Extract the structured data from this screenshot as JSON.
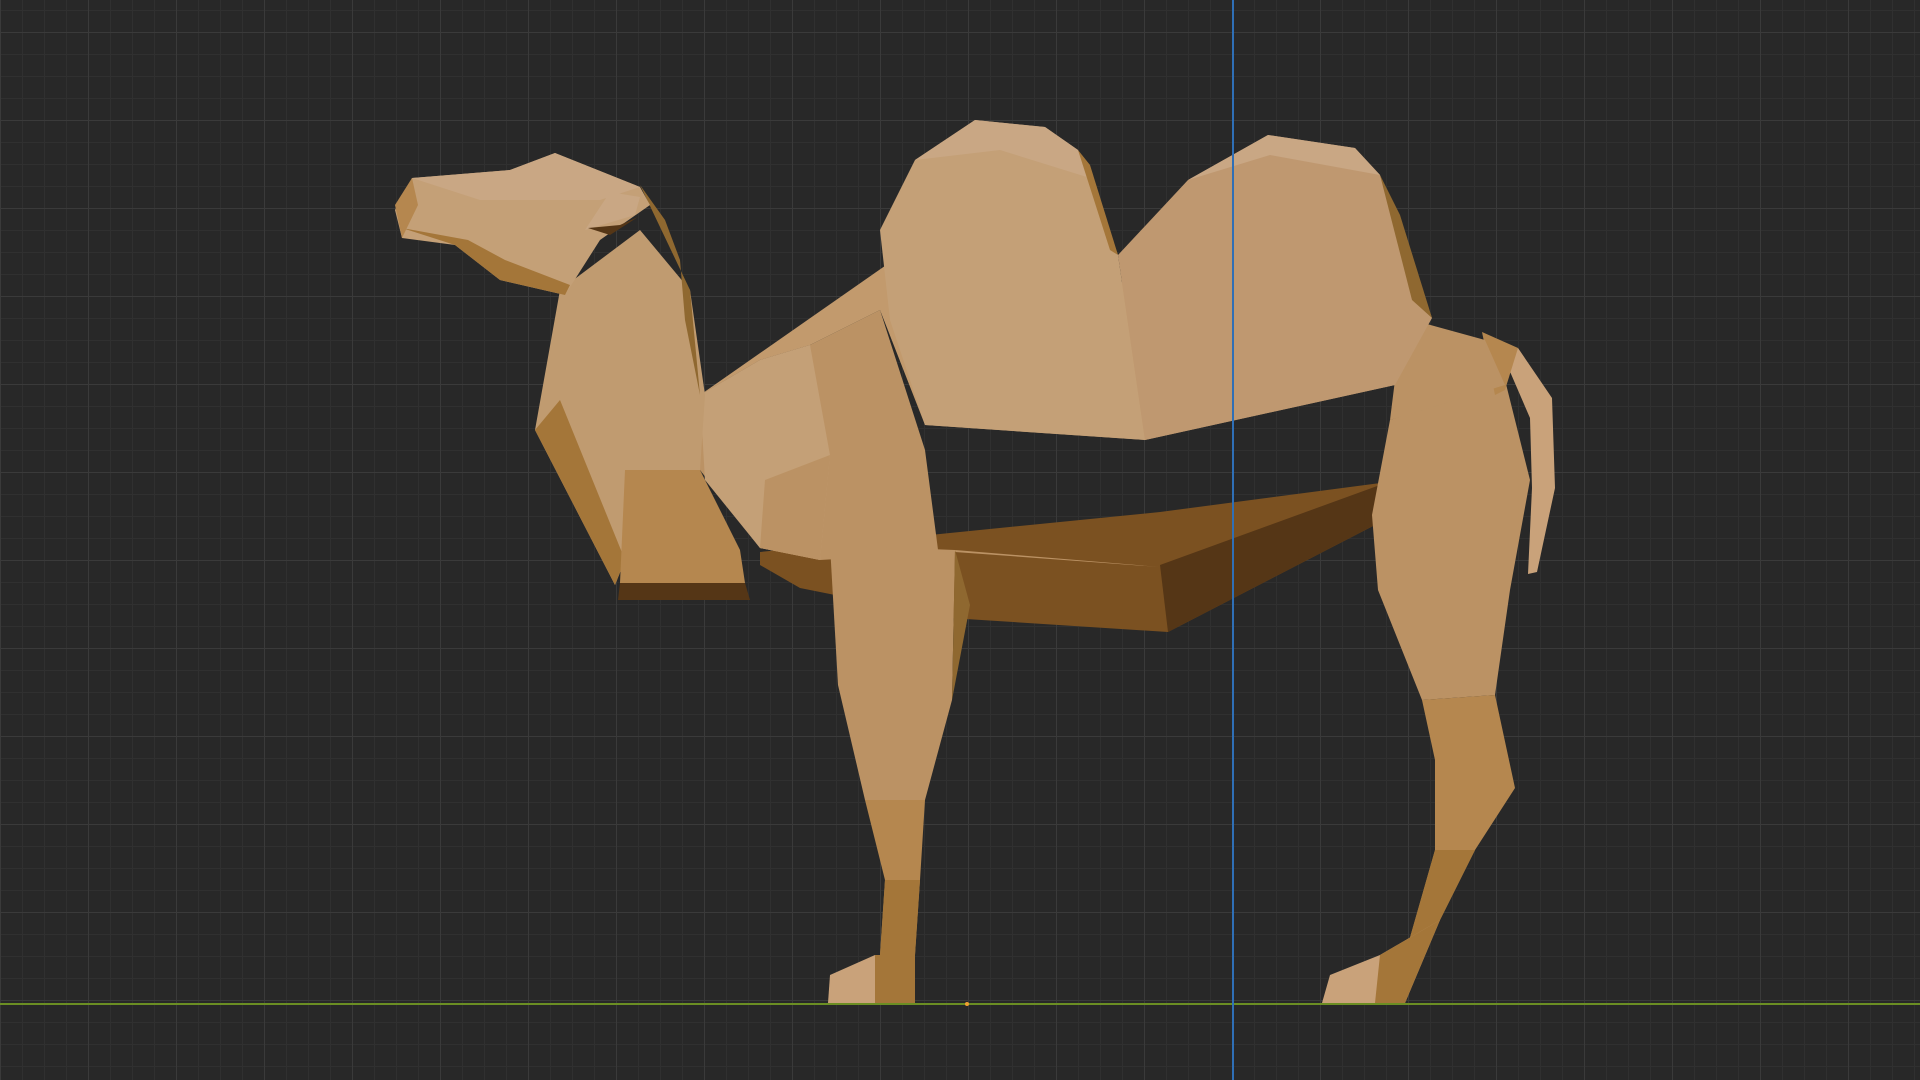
{
  "viewport": {
    "background": "#282828",
    "grid_color": "#3a3a3a",
    "axis_x_color": "#6b8e23",
    "axis_z_color": "#2f6fb6",
    "origin_color": "#f0a030"
  },
  "object": {
    "name": "camel",
    "style": "low-poly",
    "colors": {
      "light": "#c9a27a",
      "base": "#bb9264",
      "mid": "#b5874f",
      "dark": "#a47639",
      "shadow": "#7b5121",
      "deep": "#553616"
    }
  }
}
